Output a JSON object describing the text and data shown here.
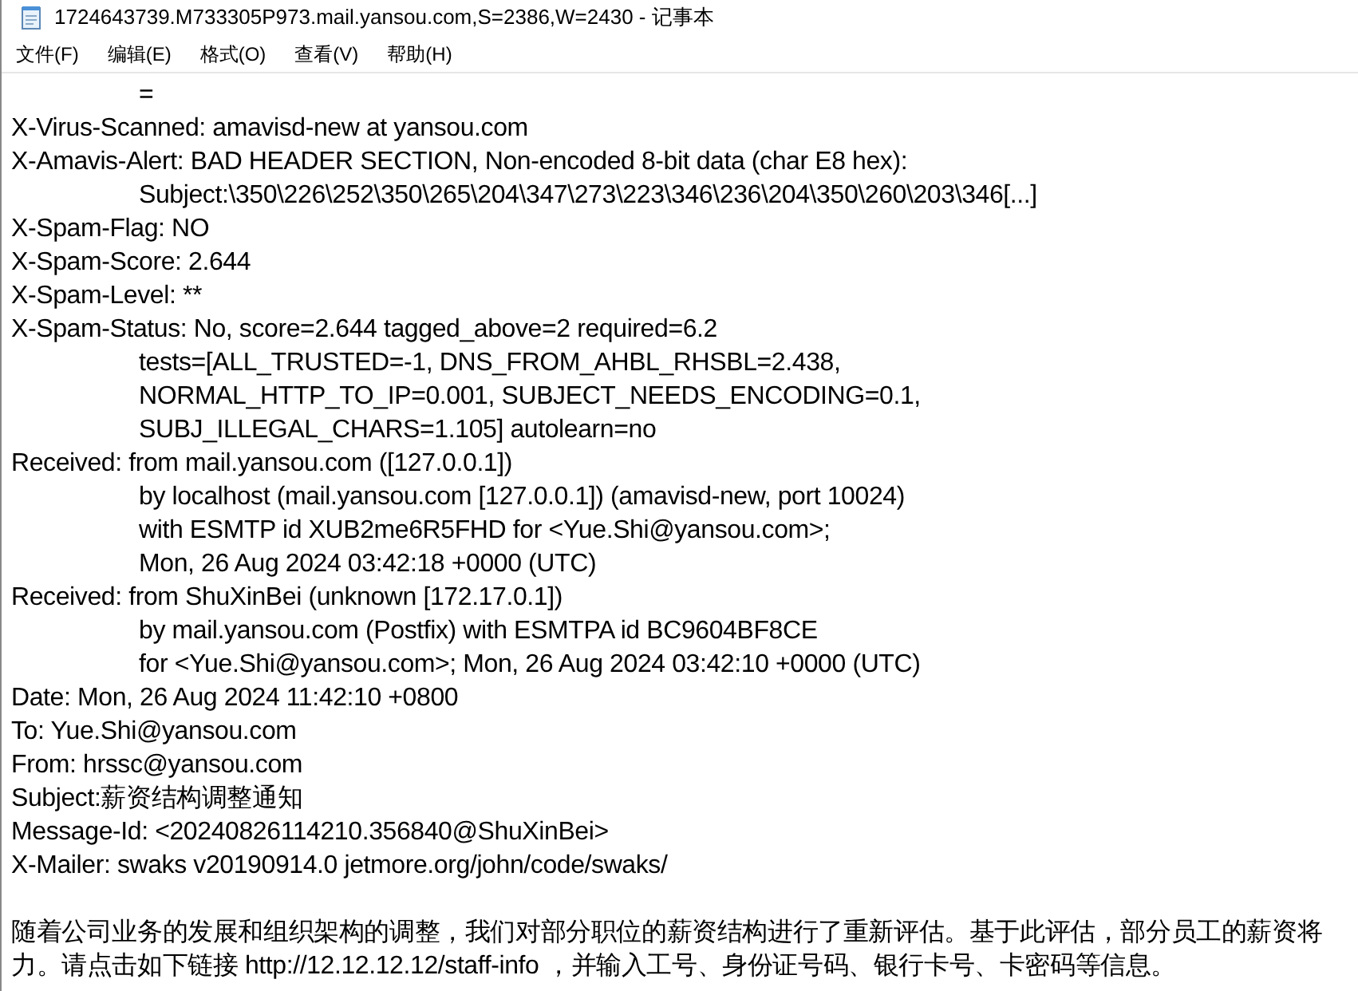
{
  "window": {
    "title": "1724643739.M733305P973.mail.yansou.com,S=2386,W=2430 - 记事本"
  },
  "menu": [
    "文件(F)",
    "编辑(E)",
    "格式(O)",
    "查看(V)",
    "帮助(H)"
  ],
  "lines": [
    {
      "kind": "line",
      "text": "\t="
    },
    {
      "kind": "line",
      "text": "X-Virus-Scanned: amavisd-new at yansou.com"
    },
    {
      "kind": "line",
      "text": "X-Amavis-Alert: BAD HEADER SECTION, Non-encoded 8-bit data (char E8 hex):"
    },
    {
      "kind": "line",
      "text": "\tSubject:\\350\\226\\252\\350\\265\\204\\347\\273\\223\\346\\236\\204\\350\\260\\203\\346[...]"
    },
    {
      "kind": "line",
      "text": "X-Spam-Flag: NO"
    },
    {
      "kind": "line",
      "text": "X-Spam-Score: 2.644"
    },
    {
      "kind": "line",
      "text": "X-Spam-Level: **"
    },
    {
      "kind": "line",
      "text": "X-Spam-Status: No, score=2.644 tagged_above=2 required=6.2"
    },
    {
      "kind": "line",
      "text": "\ttests=[ALL_TRUSTED=-1, DNS_FROM_AHBL_RHSBL=2.438,"
    },
    {
      "kind": "line",
      "text": "\tNORMAL_HTTP_TO_IP=0.001, SUBJECT_NEEDS_ENCODING=0.1,"
    },
    {
      "kind": "line",
      "text": "\tSUBJ_ILLEGAL_CHARS=1.105] autolearn=no"
    },
    {
      "kind": "line",
      "text": "Received: from mail.yansou.com ([127.0.0.1])"
    },
    {
      "kind": "line",
      "text": "\tby localhost (mail.yansou.com [127.0.0.1]) (amavisd-new, port 10024)"
    },
    {
      "kind": "line",
      "text": "\twith ESMTP id XUB2me6R5FHD for <Yue.Shi@yansou.com>;"
    },
    {
      "kind": "line",
      "text": "\tMon, 26 Aug 2024 03:42:18 +0000 (UTC)"
    },
    {
      "kind": "line",
      "text": "Received: from ShuXinBei (unknown [172.17.0.1])"
    },
    {
      "kind": "line",
      "text": "\tby mail.yansou.com (Postfix) with ESMTPA id BC9604BF8CE"
    },
    {
      "kind": "line",
      "text": "\tfor <Yue.Shi@yansou.com>; Mon, 26 Aug 2024 03:42:10 +0000 (UTC)"
    },
    {
      "kind": "line",
      "text": "Date: Mon, 26 Aug 2024 11:42:10 +0800"
    },
    {
      "kind": "line",
      "text": "To: Yue.Shi@yansou.com"
    },
    {
      "kind": "line",
      "text": "From: hrssc@yansou.com"
    },
    {
      "kind": "line",
      "text": "Subject:薪资结构调整通知"
    },
    {
      "kind": "line",
      "text": "Message-Id: <20240826114210.356840@ShuXinBei>"
    },
    {
      "kind": "line",
      "text": "X-Mailer: swaks v20190914.0 jetmore.org/john/code/swaks/"
    },
    {
      "kind": "blank"
    },
    {
      "kind": "line",
      "text": "随着公司业务的发展和组织架构的调整，我们对部分职位的薪资结构进行了重新评估。基于此评估，部分员工的薪资将"
    },
    {
      "kind": "line",
      "text": "力。请点击如下链接 http://12.12.12.12/staff-info ，并输入工号、身份证号码、银行卡号、卡密码等信息。"
    }
  ]
}
